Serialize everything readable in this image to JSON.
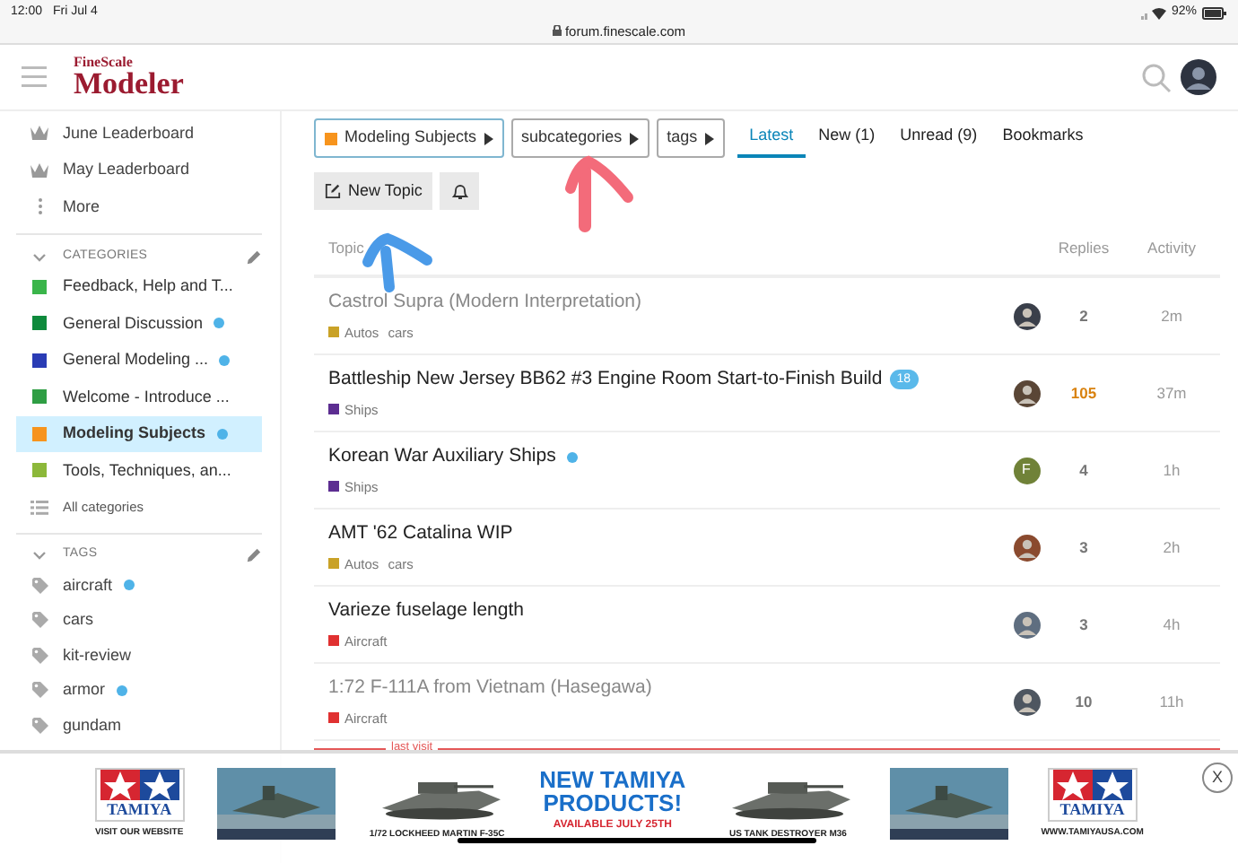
{
  "status_bar": {
    "time": "12:00",
    "date": "Fri Jul 4",
    "url": "forum.finescale.com",
    "battery": "92%"
  },
  "header": {
    "logo_top": "FineScale",
    "logo_main": "Modeler"
  },
  "sidebar": {
    "links": [
      {
        "kind": "leaderboard",
        "label": "June Leaderboard"
      },
      {
        "kind": "leaderboard",
        "label": "May Leaderboard"
      },
      {
        "kind": "more",
        "label": "More"
      }
    ],
    "categories_heading": "CATEGORIES",
    "categories": [
      {
        "label": "Feedback, Help and T...",
        "color": "#3ab54a",
        "unread": false,
        "selected": false
      },
      {
        "label": "General Discussion",
        "color": "#0e8a3c",
        "unread": true,
        "selected": false
      },
      {
        "label": "General Modeling ...",
        "color": "#2a3cb5",
        "unread": true,
        "selected": false
      },
      {
        "label": "Welcome - Introduce ...",
        "color": "#2f9e44",
        "unread": false,
        "selected": false
      },
      {
        "label": "Modeling Subjects",
        "color": "#f7941d",
        "unread": true,
        "selected": true
      },
      {
        "label": "Tools, Techniques, an...",
        "color": "#8cb83a",
        "unread": false,
        "selected": false
      }
    ],
    "all_categories": "All categories",
    "tags_heading": "TAGS",
    "tags": [
      {
        "label": "aircraft",
        "unread": true
      },
      {
        "label": "cars",
        "unread": false
      },
      {
        "label": "kit-review",
        "unread": false
      },
      {
        "label": "armor",
        "unread": true
      },
      {
        "label": "gundam",
        "unread": false
      }
    ]
  },
  "filters": [
    {
      "label": "Modeling Subjects",
      "color": "#f7941d",
      "selected": true
    },
    {
      "label": "subcategories",
      "selected": false
    },
    {
      "label": "tags",
      "selected": false
    }
  ],
  "tabs": [
    {
      "label": "Latest",
      "selected": true
    },
    {
      "label": "New (1)",
      "selected": false
    },
    {
      "label": "Unread (9)",
      "selected": false
    },
    {
      "label": "Bookmarks",
      "selected": false
    }
  ],
  "new_topic": "New Topic",
  "table": {
    "columns": [
      "Topic",
      "Replies",
      "Activity"
    ],
    "rows": [
      {
        "title": "Castrol Supra (Modern Interpretation)",
        "visited": true,
        "category": "Autos",
        "color": "#c9a227",
        "tags": [
          "cars"
        ],
        "unread": false,
        "avatar": {
          "kind": "picture"
        },
        "replies": "2",
        "hot": false,
        "activity": "2m"
      },
      {
        "title": "Battleship New Jersey BB62 #3 Engine Room Start-to-Finish Build",
        "visited": false,
        "category": "Ships",
        "color": "#5c2d91",
        "count": "18",
        "unread": false,
        "avatar": {
          "kind": "picture"
        },
        "replies": "105",
        "hot": true,
        "activity": "37m"
      },
      {
        "title": "Korean War Auxiliary Ships",
        "visited": false,
        "category": "Ships",
        "color": "#5c2d91",
        "unread": true,
        "avatar": {
          "kind": "letter",
          "letter": "F"
        },
        "replies": "4",
        "hot": false,
        "activity": "1h"
      },
      {
        "title": "AMT '62 Catalina WIP",
        "visited": false,
        "category": "Autos",
        "color": "#c9a227",
        "tags": [
          "cars"
        ],
        "unread": false,
        "avatar": {
          "kind": "picture"
        },
        "replies": "3",
        "hot": false,
        "activity": "2h"
      },
      {
        "title": "Varieze fuselage length",
        "visited": false,
        "category": "Aircraft",
        "color": "#e03131",
        "unread": false,
        "avatar": {
          "kind": "picture"
        },
        "replies": "3",
        "hot": false,
        "activity": "4h"
      },
      {
        "title": "1:72 F-111A from Vietnam (Hasegawa)",
        "visited": true,
        "category": "Aircraft",
        "color": "#e03131",
        "unread": false,
        "avatar": {
          "kind": "picture"
        },
        "replies": "10",
        "hot": false,
        "activity": "11h"
      }
    ],
    "last_visit": "last visit"
  },
  "ad": {
    "items": [
      {
        "kind": "logo",
        "logo_text": "TAMIYA",
        "caption": "VISIT OUR WEBSITE"
      },
      {
        "kind": "picture"
      },
      {
        "kind": "picture",
        "caption": "1/72 LOCKHEED MARTIN F-35C"
      },
      {
        "kind": "headline",
        "lines": [
          "NEW TAMIYA",
          "PRODUCTS!"
        ],
        "caption": "AVAILABLE JULY 25TH"
      },
      {
        "kind": "picture",
        "caption": "US TANK DESTROYER M36"
      },
      {
        "kind": "picture"
      },
      {
        "kind": "logo",
        "logo_text": "TAMIYA",
        "caption": "WWW.TAMIYAUSA.COM"
      }
    ],
    "close": "X"
  }
}
